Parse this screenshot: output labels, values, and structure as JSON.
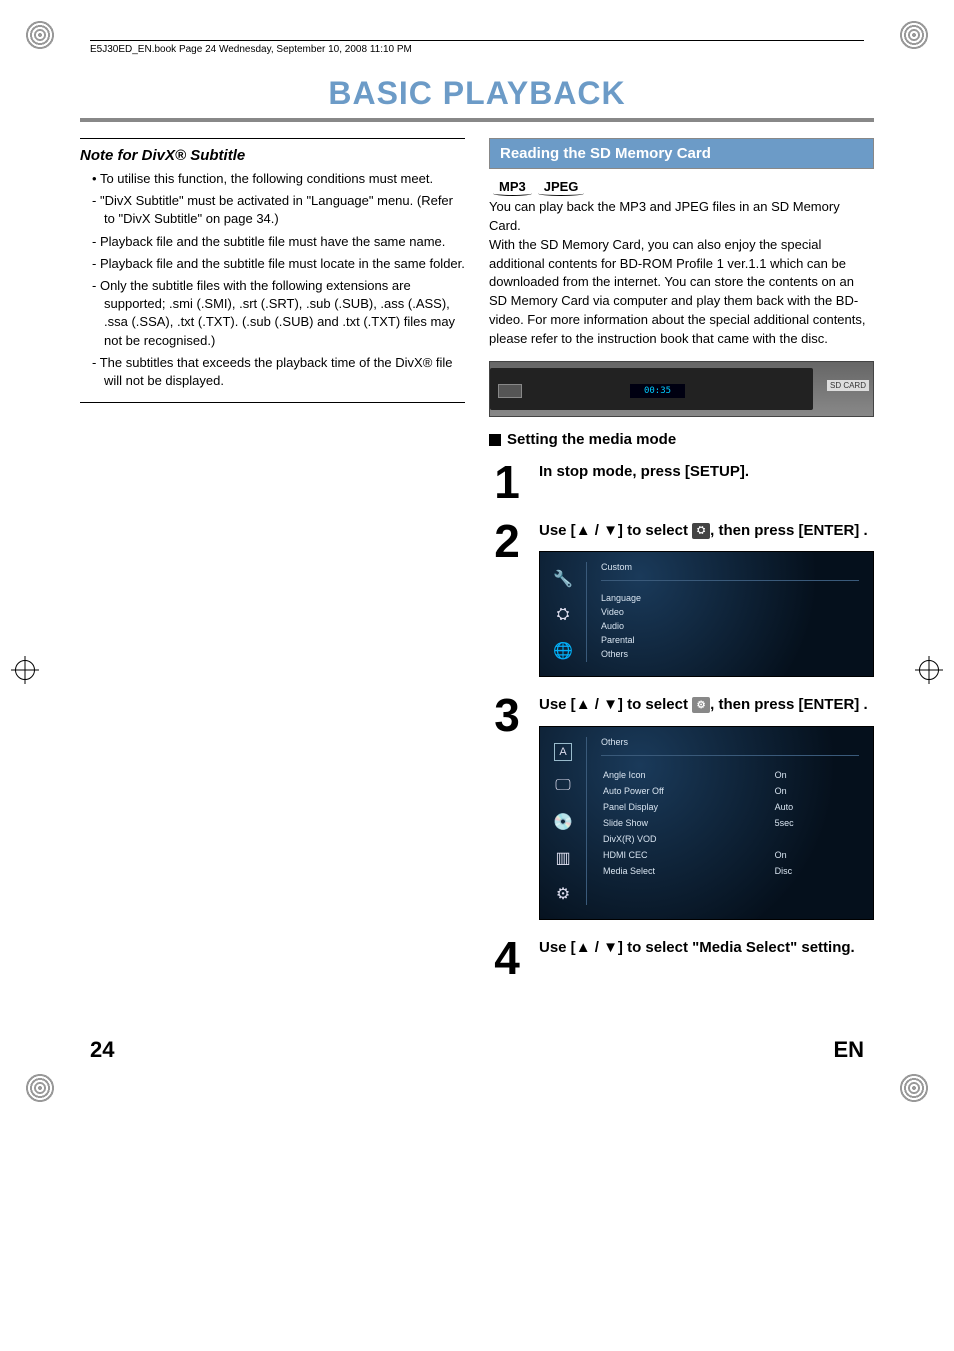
{
  "book_header": "E5J30ED_EN.book  Page 24  Wednesday, September 10, 2008  11:10 PM",
  "title": "BASIC PLAYBACK",
  "note": {
    "heading": "Note for DivX® Subtitle",
    "items": [
      {
        "style": "bullet",
        "text": "To utilise this function, the following conditions must meet."
      },
      {
        "style": "dash",
        "text": "\"DivX Subtitle\" must be activated in \"Language\" menu. (Refer to \"DivX Subtitle\" on page 34.)"
      },
      {
        "style": "dash",
        "text": "Playback file and the subtitle file must have the same name."
      },
      {
        "style": "dash",
        "text": "Playback file and the subtitle file must locate in the same folder."
      },
      {
        "style": "dash",
        "text": "Only the subtitle files with the following extensions are supported; .smi (.SMI), .srt (.SRT), .sub (.SUB), .ass (.ASS), .ssa (.SSA), .txt (.TXT). (.sub (.SUB) and .txt (.TXT) files may not be recognised.)"
      },
      {
        "style": "dash",
        "text": "The subtitles that exceeds the playback time of the DivX® file will not be displayed."
      }
    ]
  },
  "section_header": "Reading the SD Memory Card",
  "badges": [
    "MP3",
    "JPEG"
  ],
  "intro": "You can play back the MP3 and JPEG files in an SD Memory Card.\nWith the SD Memory Card, you can also enjoy the special additional contents for BD-ROM Profile 1 ver.1.1 which can be downloaded from the internet. You can store the contents on an SD Memory Card via computer and play them back with the BD-video. For more information about the special additional contents, please refer to the instruction book that came with the disc.",
  "player": {
    "display": "00:35",
    "label": "SD CARD"
  },
  "subheading": "Setting the media mode",
  "steps": {
    "s1": {
      "num": "1",
      "text": "In stop mode, press [SETUP]."
    },
    "s2": {
      "num": "2",
      "pre": "Use [",
      "mid": " / ",
      "post": "] to select ",
      "tail": ", then press [ENTER] ."
    },
    "s3": {
      "num": "3",
      "pre": "Use [",
      "mid": " / ",
      "post": "] to select ",
      "tail": ", then press [ENTER] ."
    },
    "s4": {
      "num": "4",
      "pre": "Use [",
      "mid": " / ",
      "post": "] to select \"Media Select\" setting."
    }
  },
  "menu1": {
    "header": "Custom",
    "items": [
      "Language",
      "Video",
      "Audio",
      "Parental",
      "Others"
    ]
  },
  "menu2": {
    "header": "Others",
    "rows": [
      {
        "label": "Angle Icon",
        "value": "On"
      },
      {
        "label": "Auto Power Off",
        "value": "On"
      },
      {
        "label": "Panel Display",
        "value": "Auto"
      },
      {
        "label": "Slide Show",
        "value": "5sec"
      },
      {
        "label": "DivX(R) VOD",
        "value": ""
      },
      {
        "label": "HDMI CEC",
        "value": "On"
      },
      {
        "label": "Media Select",
        "value": "Disc"
      }
    ]
  },
  "footer": {
    "page": "24",
    "lang": "EN"
  }
}
